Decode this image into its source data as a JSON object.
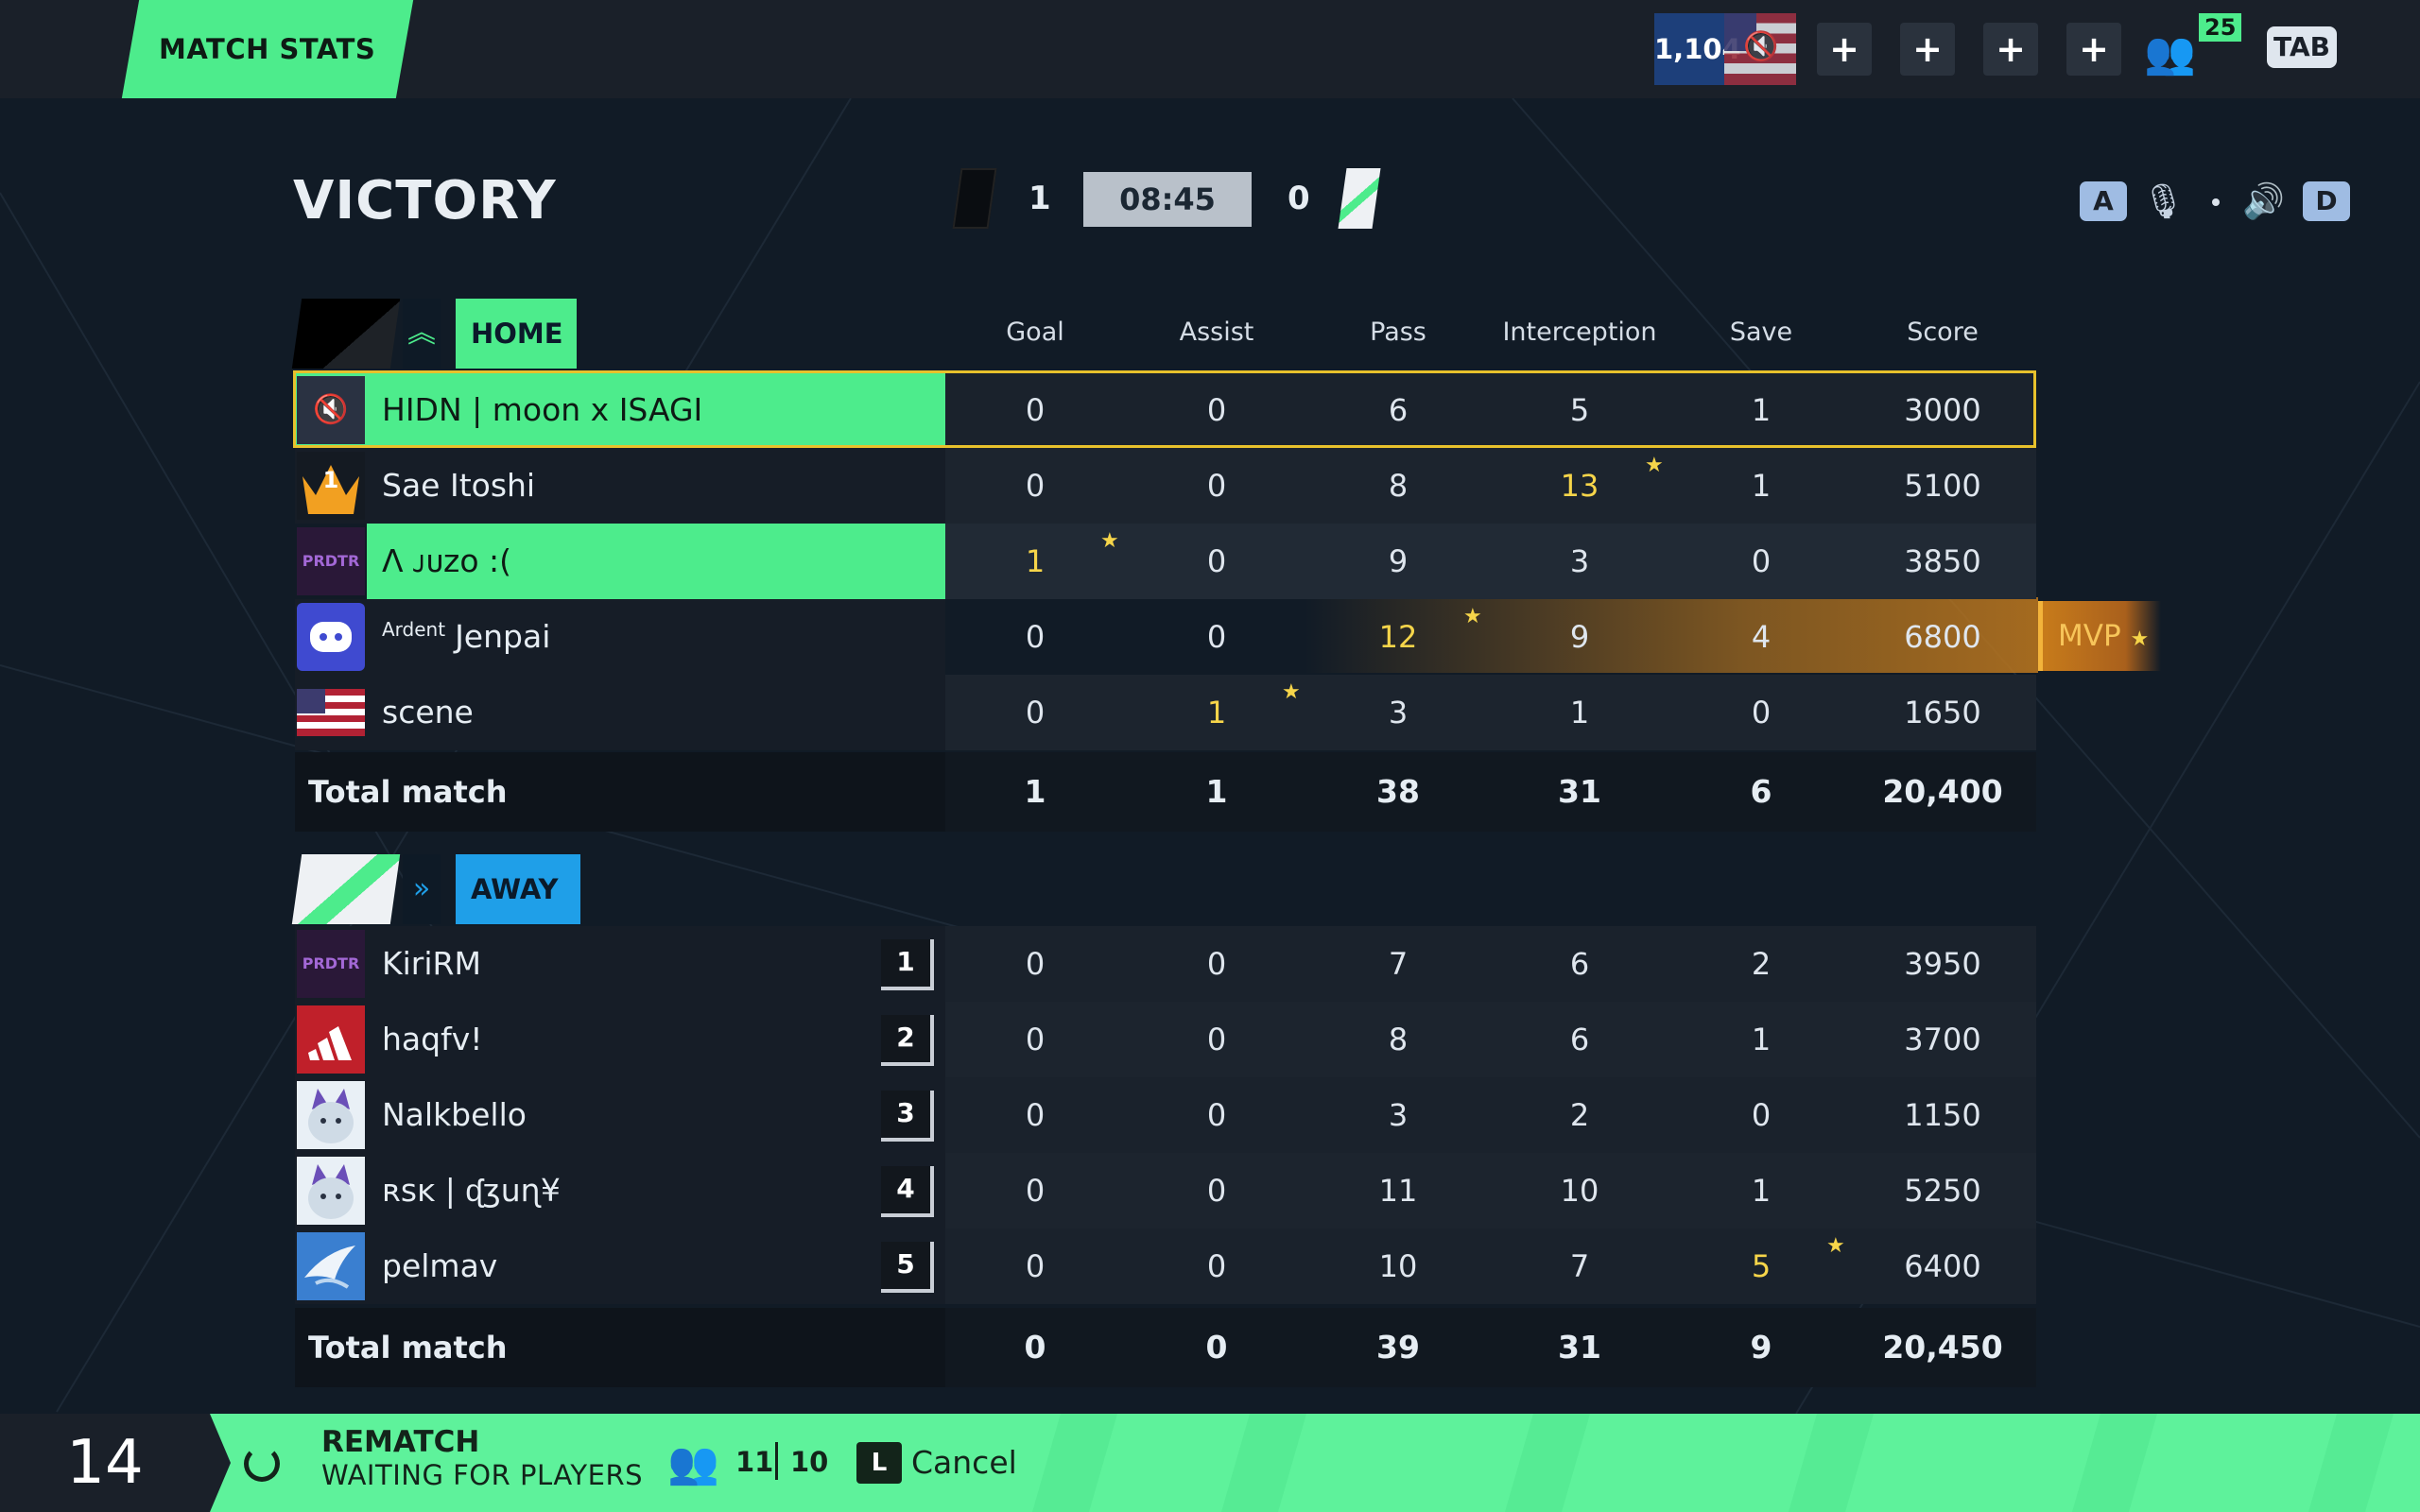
{
  "topbar": {
    "title": "MATCH STATS",
    "coins": "1,104",
    "party_count": "25",
    "tab_key": "TAB",
    "plus_buttons": [
      "+",
      "+",
      "+",
      "+"
    ]
  },
  "header": {
    "result": "VICTORY",
    "home_score": "1",
    "timer": "08:45",
    "away_score": "0",
    "key_left": "A",
    "key_right": "D"
  },
  "columns": [
    "Goal",
    "Assist",
    "Pass",
    "Interception",
    "Save",
    "Score"
  ],
  "home": {
    "name": "HOME",
    "players": [
      {
        "name": "HIDN | moon x ISAGI",
        "stats": [
          "0",
          "0",
          "6",
          "5",
          "1",
          "3000"
        ]
      },
      {
        "name": "Sae Itoshi",
        "stats": [
          "0",
          "0",
          "8",
          "13",
          "1",
          "5100"
        ]
      },
      {
        "name": "Λ ᴊᴜᴢᴏ :(",
        "stats": [
          "1",
          "0",
          "9",
          "3",
          "0",
          "3850"
        ]
      },
      {
        "name": "Jenpai",
        "tag": "Ardent",
        "stats": [
          "0",
          "0",
          "12",
          "9",
          "4",
          "6800"
        ],
        "mvp": "MVP"
      },
      {
        "name": "scene",
        "stats": [
          "0",
          "1",
          "3",
          "1",
          "0",
          "1650"
        ]
      }
    ],
    "total_label": "Total match",
    "totals": [
      "1",
      "1",
      "38",
      "31",
      "6",
      "20,400"
    ]
  },
  "away": {
    "name": "AWAY",
    "players": [
      {
        "name": "KiriRM",
        "rank": "1",
        "stats": [
          "0",
          "0",
          "7",
          "6",
          "2",
          "3950"
        ]
      },
      {
        "name": "haqfv!",
        "rank": "2",
        "stats": [
          "0",
          "0",
          "8",
          "6",
          "1",
          "3700"
        ]
      },
      {
        "name": "Nalkbello",
        "rank": "3",
        "stats": [
          "0",
          "0",
          "3",
          "2",
          "0",
          "1150"
        ]
      },
      {
        "name": "ʀsᴋ | ᶑʒuɳ¥",
        "rank": "4",
        "stats": [
          "0",
          "0",
          "11",
          "10",
          "1",
          "5250"
        ]
      },
      {
        "name": "pelmav",
        "rank": "5",
        "stats": [
          "0",
          "0",
          "10",
          "7",
          "5",
          "6400"
        ]
      }
    ],
    "total_label": "Total match",
    "totals": [
      "0",
      "0",
      "39",
      "31",
      "9",
      "20,450"
    ]
  },
  "bottombar": {
    "countdown": "14",
    "title": "REMATCH",
    "subtitle": "WAITING FOR PLAYERS",
    "ready": "11",
    "total": "10",
    "cancel_key": "L",
    "cancel_label": "Cancel"
  },
  "colors": {
    "accent_green": "#4dec8c",
    "away_blue": "#1f9fe8",
    "highlight": "#f6d54a",
    "mvp": "#c77b1b"
  }
}
